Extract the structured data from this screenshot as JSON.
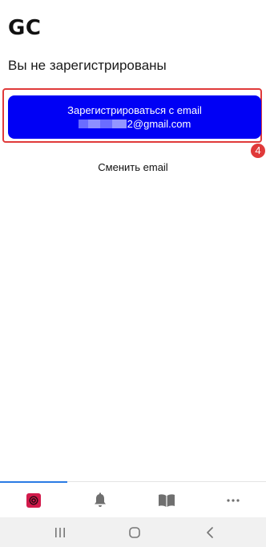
{
  "app": {
    "title": "GC"
  },
  "main": {
    "status_text": "Вы не зарегистрированы",
    "register_button": {
      "line1": "Зарегистрироваться с email",
      "email_visible_suffix": "2@gmail.com"
    },
    "change_email_label": "Сменить email",
    "annotation_badge": "4"
  },
  "bottom_nav": {
    "items": [
      {
        "icon": "app-logo-icon",
        "active": true
      },
      {
        "icon": "bell-icon",
        "active": false
      },
      {
        "icon": "book-icon",
        "active": false
      },
      {
        "icon": "more-dots-icon",
        "active": false
      }
    ],
    "active_color": "#2a7be4"
  },
  "system_nav": {
    "buttons": [
      "recent-apps-icon",
      "home-icon",
      "back-icon"
    ]
  },
  "colors": {
    "primary_button": "#0000f5",
    "highlight": "#e03a3a"
  }
}
